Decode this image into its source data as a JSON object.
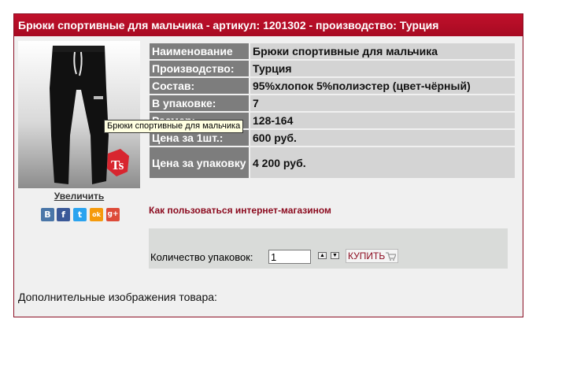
{
  "product": {
    "header_title": "Брюки спортивные для мальчика - артикул: 1201302 - производство: Турция",
    "image_tooltip": "Брюки спортивные для мальчика",
    "enlarge_link": "Увеличить",
    "specs": [
      {
        "label": "Наименование",
        "value": "Брюки спортивные для мальчика"
      },
      {
        "label": "Производство:",
        "value": "Турция"
      },
      {
        "label": "Состав:",
        "value": "95%хлопок 5%полиэстер (цвет-чёрный)"
      },
      {
        "label": "В упаковке:",
        "value": "7"
      },
      {
        "label": "Размер:",
        "value": "128-164"
      },
      {
        "label": "Цена за 1шт.:",
        "value": "600 руб."
      },
      {
        "label": "Цена за упаковку",
        "value": "4 200 руб."
      }
    ],
    "howto_link": "Как пользоваться интернет-магазином",
    "quantity_label": "Количество упаковок:",
    "quantity_value": "1",
    "buy_button": "КУПИТЬ",
    "extra_images_label": "Дополнительные изображения товара:"
  },
  "social": [
    {
      "icon": "vk-icon",
      "glyph": "B",
      "color": "#4a76a8"
    },
    {
      "icon": "facebook-icon",
      "glyph": "f",
      "color": "#3b5998"
    },
    {
      "icon": "twitter-icon",
      "glyph": "t",
      "color": "#2aa3ef"
    },
    {
      "icon": "odnoklassniki-icon",
      "glyph": "ok",
      "color": "#f59a0c"
    },
    {
      "icon": "google-plus-icon",
      "glyph": "g+",
      "color": "#dd4b39"
    }
  ],
  "colors": {
    "accent": "#a70a22",
    "link": "#8b0a1e",
    "spec_label_bg": "#7d7d7d",
    "spec_value_bg": "#d4d4d4"
  }
}
